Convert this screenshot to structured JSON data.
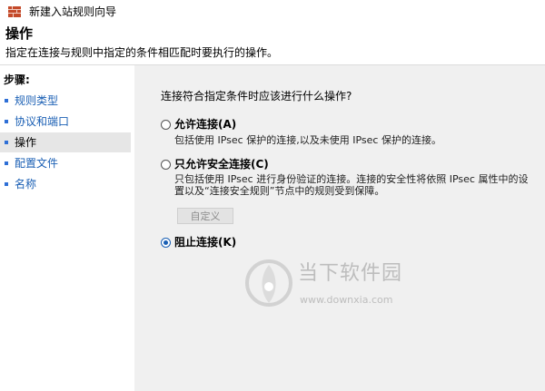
{
  "window": {
    "title": "新建入站规则向导"
  },
  "header": {
    "title": "操作",
    "subtitle": "指定在连接与规则中指定的条件相匹配时要执行的操作。"
  },
  "sidebar": {
    "title": "步骤:",
    "items": [
      {
        "label": "规则类型",
        "active": false
      },
      {
        "label": "协议和端口",
        "active": false
      },
      {
        "label": "操作",
        "active": true
      },
      {
        "label": "配置文件",
        "active": false
      },
      {
        "label": "名称",
        "active": false
      }
    ]
  },
  "main": {
    "question": "连接符合指定条件时应该进行什么操作?",
    "options": [
      {
        "label": "允许连接(A)",
        "description": "包括使用 IPsec 保护的连接,以及未使用 IPsec 保护的连接。",
        "selected": false
      },
      {
        "label": "只允许安全连接(C)",
        "description_line1": "只包括使用 IPsec 进行身份验证的连接。连接的安全性将依照 IPsec 属性中的设",
        "description_line2": "置以及“连接安全规则”节点中的规则受到保障。",
        "selected": false
      },
      {
        "label": "阻止连接(K)",
        "selected": true
      }
    ],
    "customize_label": "自定义"
  },
  "watermark": {
    "text": "当下软件园",
    "url": "www.downxia.com"
  },
  "colors": {
    "accent": "#1a5fb4",
    "panel_bg": "#f0f0f0",
    "active_step_bg": "#e6e6e6"
  }
}
